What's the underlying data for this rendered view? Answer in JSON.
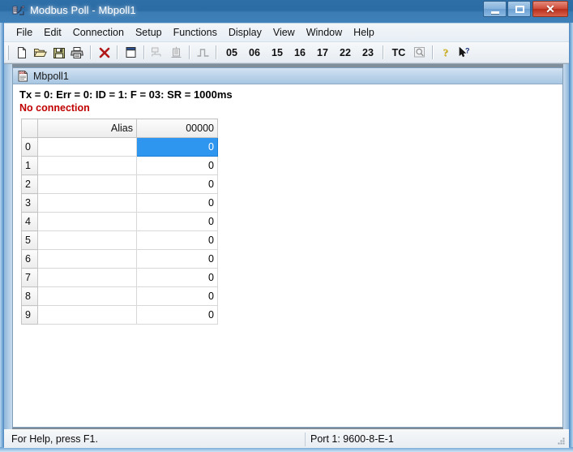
{
  "window": {
    "title": "Modbus Poll - Mbpoll1",
    "app_icon": "modbus-poll-app-icon",
    "minimize_label": "Minimize",
    "maximize_label": "Maximize",
    "close_label": "Close",
    "close_glyph": "✕"
  },
  "menu": {
    "items": [
      {
        "label": "File"
      },
      {
        "label": "Edit"
      },
      {
        "label": "Connection"
      },
      {
        "label": "Setup"
      },
      {
        "label": "Functions"
      },
      {
        "label": "Display"
      },
      {
        "label": "View"
      },
      {
        "label": "Window"
      },
      {
        "label": "Help"
      }
    ]
  },
  "toolbar": {
    "buttons": [
      {
        "name": "new-file-icon",
        "tooltip": "New",
        "enabled": true
      },
      {
        "name": "open-folder-icon",
        "tooltip": "Open",
        "enabled": true
      },
      {
        "name": "save-floppy-icon",
        "tooltip": "Save",
        "enabled": true
      },
      {
        "name": "print-icon",
        "tooltip": "Print",
        "enabled": true
      },
      {
        "name": "disconnect-x-icon",
        "tooltip": "Disconnect",
        "enabled": true
      },
      {
        "name": "new-window-icon",
        "tooltip": "New Window",
        "enabled": true
      },
      {
        "name": "read-write-def-icon",
        "tooltip": "Read/Write Definition",
        "enabled": false
      },
      {
        "name": "poll-device-icon",
        "tooltip": "Poll Device",
        "enabled": false
      },
      {
        "name": "pulse-signal-icon",
        "tooltip": "Signal",
        "enabled": false
      }
    ],
    "function_codes": [
      "05",
      "06",
      "15",
      "16",
      "17",
      "22",
      "23"
    ],
    "tc_label": "TC",
    "tc_icon": "test-center-magnifier-icon",
    "help_icon": "help-question-icon",
    "context_help_icon": "context-help-arrow-icon"
  },
  "mdi": {
    "title": "Mbpoll1",
    "icon": "document-doc-icon",
    "status_line": "Tx = 0: Err = 0: ID = 1: F = 03: SR = 1000ms",
    "connection_status": "No connection",
    "connection_status_color": "#c00000"
  },
  "grid": {
    "headers": {
      "corner": "",
      "alias": "Alias",
      "address": "00000"
    },
    "rows": [
      {
        "index": "0",
        "alias": "",
        "value": "0",
        "selected": true
      },
      {
        "index": "1",
        "alias": "",
        "value": "0",
        "selected": false
      },
      {
        "index": "2",
        "alias": "",
        "value": "0",
        "selected": false
      },
      {
        "index": "3",
        "alias": "",
        "value": "0",
        "selected": false
      },
      {
        "index": "4",
        "alias": "",
        "value": "0",
        "selected": false
      },
      {
        "index": "5",
        "alias": "",
        "value": "0",
        "selected": false
      },
      {
        "index": "6",
        "alias": "",
        "value": "0",
        "selected": false
      },
      {
        "index": "7",
        "alias": "",
        "value": "0",
        "selected": false
      },
      {
        "index": "8",
        "alias": "",
        "value": "0",
        "selected": false
      },
      {
        "index": "9",
        "alias": "",
        "value": "0",
        "selected": false
      }
    ],
    "selection_color": "#2f96f0"
  },
  "statusbar": {
    "help_text": "For Help, press F1.",
    "port_text": "Port 1: 9600-8-E-1",
    "resize_grip": "resize-grip-icon"
  }
}
